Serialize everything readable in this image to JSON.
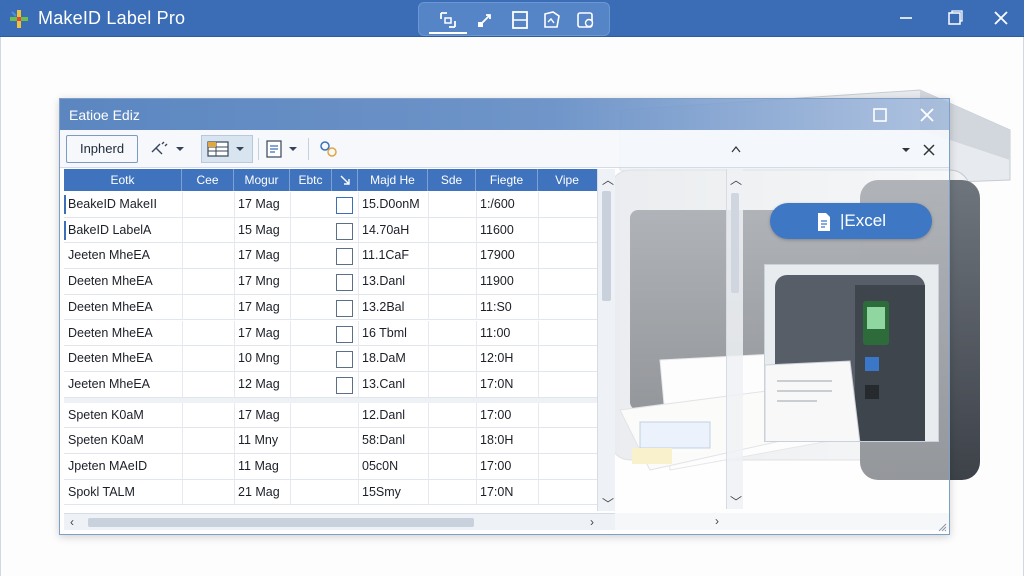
{
  "app": {
    "title": "MakeID Label Pro"
  },
  "dialog": {
    "title": "Eatioe Ediz",
    "toolbar": {
      "button_label": "Inpherd"
    },
    "export_button": "|Excel"
  },
  "table": {
    "columns": [
      "Eotk",
      "Cee",
      "Mogur",
      "Ebtc",
      "",
      "Majd He",
      "Sde",
      "Fiegte",
      "Vipe"
    ],
    "rows": [
      {
        "name": "BeakeID MakeII",
        "cee": "",
        "mogur": "17 Mag",
        "checked": false,
        "majd": "15.D0onM",
        "fiegte": "1:/600"
      },
      {
        "name": "BakeID LabelA",
        "cee": "",
        "mogur": "15 Mag",
        "checked": false,
        "majd": "14.70aH",
        "fiegte": "11600"
      },
      {
        "name": "Jeeten MheEA",
        "cee": "",
        "mogur": "17 Mag",
        "checked": false,
        "majd": "11.1CaF",
        "fiegte": "17900"
      },
      {
        "name": "Deeten MheEA",
        "cee": "",
        "mogur": "17 Mng",
        "checked": false,
        "majd": "13.Danl",
        "fiegte": "11900"
      },
      {
        "name": "Deeten MheEA",
        "cee": "",
        "mogur": "17 Mag",
        "checked": false,
        "majd": "13.2Bal",
        "fiegte": "11:S0"
      },
      {
        "name": "Deeten MheEA",
        "cee": "",
        "mogur": "17 Mag",
        "checked": false,
        "majd": "16 Tbml",
        "fiegte": "11:00"
      },
      {
        "name": "Deeten MheEA",
        "cee": "",
        "mogur": "10 Mng",
        "checked": false,
        "majd": "18.DaM",
        "fiegte": "12:0H"
      },
      {
        "name": "Jeeten MheEA",
        "cee": "",
        "mogur": "12 Mag",
        "checked": false,
        "majd": "13.Canl",
        "fiegte": "17:0N"
      },
      {
        "name": "Speten K0aM",
        "cee": "",
        "mogur": "17 Mag",
        "checked": null,
        "majd": "12.Danl",
        "fiegte": "17:00"
      },
      {
        "name": "Speten K0aM",
        "cee": "",
        "mogur": "11 Mny",
        "checked": null,
        "majd": "58:Danl",
        "fiegte": "18:0H"
      },
      {
        "name": "Jpeten MAeID",
        "cee": "",
        "mogur": "11 Mag",
        "checked": null,
        "majd": "05c0N",
        "fiegte": "17:00"
      },
      {
        "name": "Spokl TALM",
        "cee": "",
        "mogur": "21 Mag",
        "checked": null,
        "majd": "15Smy",
        "fiegte": "17:0N"
      }
    ]
  },
  "icons": {
    "app_logo": "makeid-logo-icon",
    "window": [
      "minimize-icon",
      "restore-icon",
      "close-icon"
    ],
    "toolbar": [
      "select-icon",
      "move-icon",
      "frame-icon",
      "image-icon",
      "database-icon"
    ]
  },
  "colors": {
    "titlebar": "#3a6db5",
    "header": "#3f73bd",
    "excel_button": "#3e78c4"
  }
}
